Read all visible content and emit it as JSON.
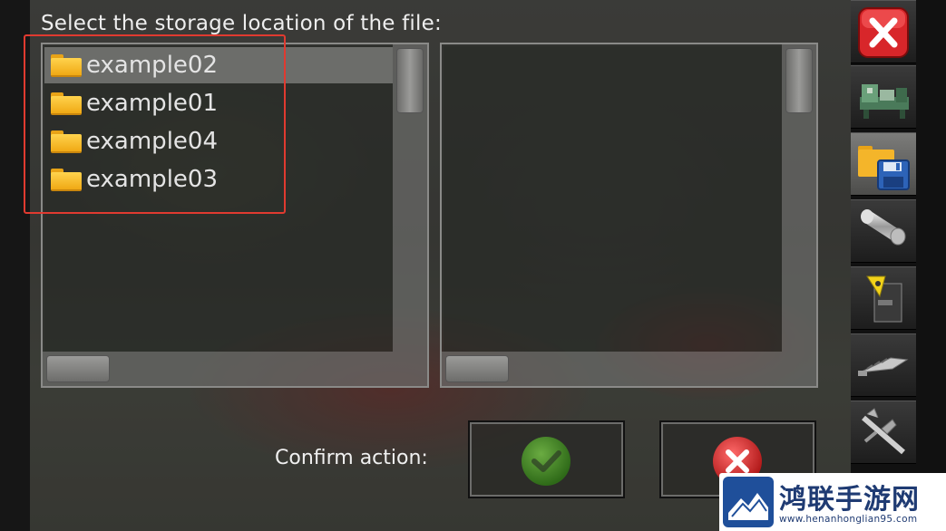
{
  "dialog": {
    "title": "Select the storage location of the file:",
    "confirm_label": "Confirm action:"
  },
  "folders": [
    {
      "name": "example02",
      "icon": "folder-icon",
      "selected": true
    },
    {
      "name": "example01",
      "icon": "folder-icon",
      "selected": false
    },
    {
      "name": "example04",
      "icon": "folder-icon",
      "selected": false
    },
    {
      "name": "example03",
      "icon": "folder-icon",
      "selected": false
    }
  ],
  "buttons": {
    "ok_icon": "check-icon",
    "cancel_icon": "x-icon"
  },
  "toolbar": [
    {
      "icon": "close-icon",
      "active": false
    },
    {
      "icon": "lathe-machine-icon",
      "active": false
    },
    {
      "icon": "folder-save-icon",
      "active": true
    },
    {
      "icon": "workpiece-cylinder-icon",
      "active": false
    },
    {
      "icon": "turning-tool-insert-icon",
      "active": false
    },
    {
      "icon": "drill-bit-icon",
      "active": false
    },
    {
      "icon": "caliper-icon",
      "active": false
    }
  ],
  "watermark": {
    "title": "鸿联手游网",
    "url": "www.henanhonglian95.com"
  },
  "colors": {
    "highlight": "#e03a30",
    "selected_row": "#787876",
    "folder": "#f0a914",
    "ok_green": "#3a9a1a",
    "cancel_red": "#d8262a"
  }
}
